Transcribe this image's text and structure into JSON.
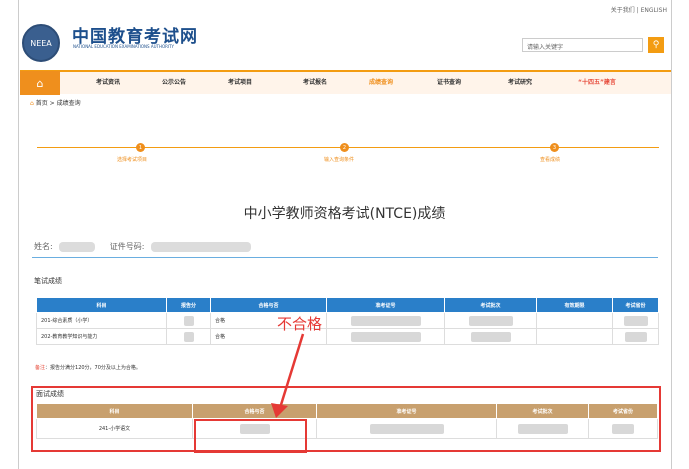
{
  "header": {
    "logo_badge": "NEEA",
    "logo_cn": "中国教育考试网",
    "logo_en": "NATIONAL EDUCATION EXAMINATIONS AUTHORITY",
    "top_links": "关于我们 | ENGLISH",
    "search_placeholder": "请输入关键字"
  },
  "nav": {
    "items": [
      {
        "label": "考试资讯"
      },
      {
        "label": "公示公告"
      },
      {
        "label": "考试项目"
      },
      {
        "label": "考试报名"
      },
      {
        "label": "成绩查询"
      },
      {
        "label": "证书查询"
      },
      {
        "label": "考试研究"
      },
      {
        "label": "“十四五”建言"
      }
    ]
  },
  "breadcrumb": {
    "home": "首页",
    "sep": ">",
    "current": "成绩查询"
  },
  "steps": [
    {
      "num": "1",
      "label": "选择考试项目"
    },
    {
      "num": "2",
      "label": "输入查询条件"
    },
    {
      "num": "3",
      "label": "查看成绩"
    }
  ],
  "page_title": "中小学教师资格考试(NTCE)成绩",
  "candidate": {
    "name_label": "姓名:",
    "id_label": "证件号码:"
  },
  "written": {
    "section_title": "笔试成绩",
    "headers": [
      "科目",
      "报告分",
      "合格与否",
      "准考证号",
      "考试批次",
      "有效期限",
      "考试省份"
    ],
    "rows": [
      {
        "subject": "201-综合素质（小学）",
        "result": "合格"
      },
      {
        "subject": "202-教育教学知识与能力",
        "result": "合格"
      }
    ],
    "note_prefix": "备注",
    "note_text": "：报告分满分120分，70分及以上为合格。"
  },
  "interview": {
    "section_title": "面试成绩",
    "headers": [
      "科目",
      "合格与否",
      "准考证号",
      "考试批次",
      "考试省份"
    ],
    "rows": [
      {
        "subject": "241-小学语文"
      }
    ]
  },
  "annotation": {
    "text": "不合格"
  },
  "colors": {
    "accent": "#ef8f1d",
    "table_header": "#2a7fc9",
    "interview_header": "#c8a06e",
    "annotation": "#e53935"
  }
}
